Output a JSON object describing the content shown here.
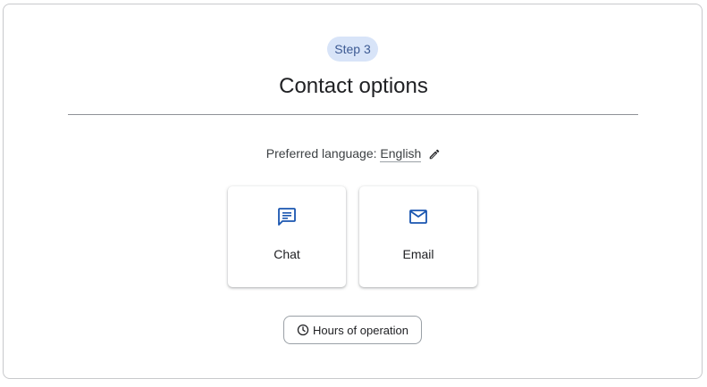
{
  "header": {
    "step_label": "Step 3",
    "title": "Contact options"
  },
  "language": {
    "label": "Preferred language:",
    "value": "English",
    "edit_icon": "pencil-icon"
  },
  "options": [
    {
      "label": "Chat",
      "icon": "chat-icon"
    },
    {
      "label": "Email",
      "icon": "mail-icon"
    }
  ],
  "hours": {
    "label": "Hours of operation",
    "icon": "clock-icon"
  },
  "colors": {
    "accent": "#1a56b0",
    "badge_bg": "#d8e4f8",
    "badge_text": "#3c5a93"
  }
}
